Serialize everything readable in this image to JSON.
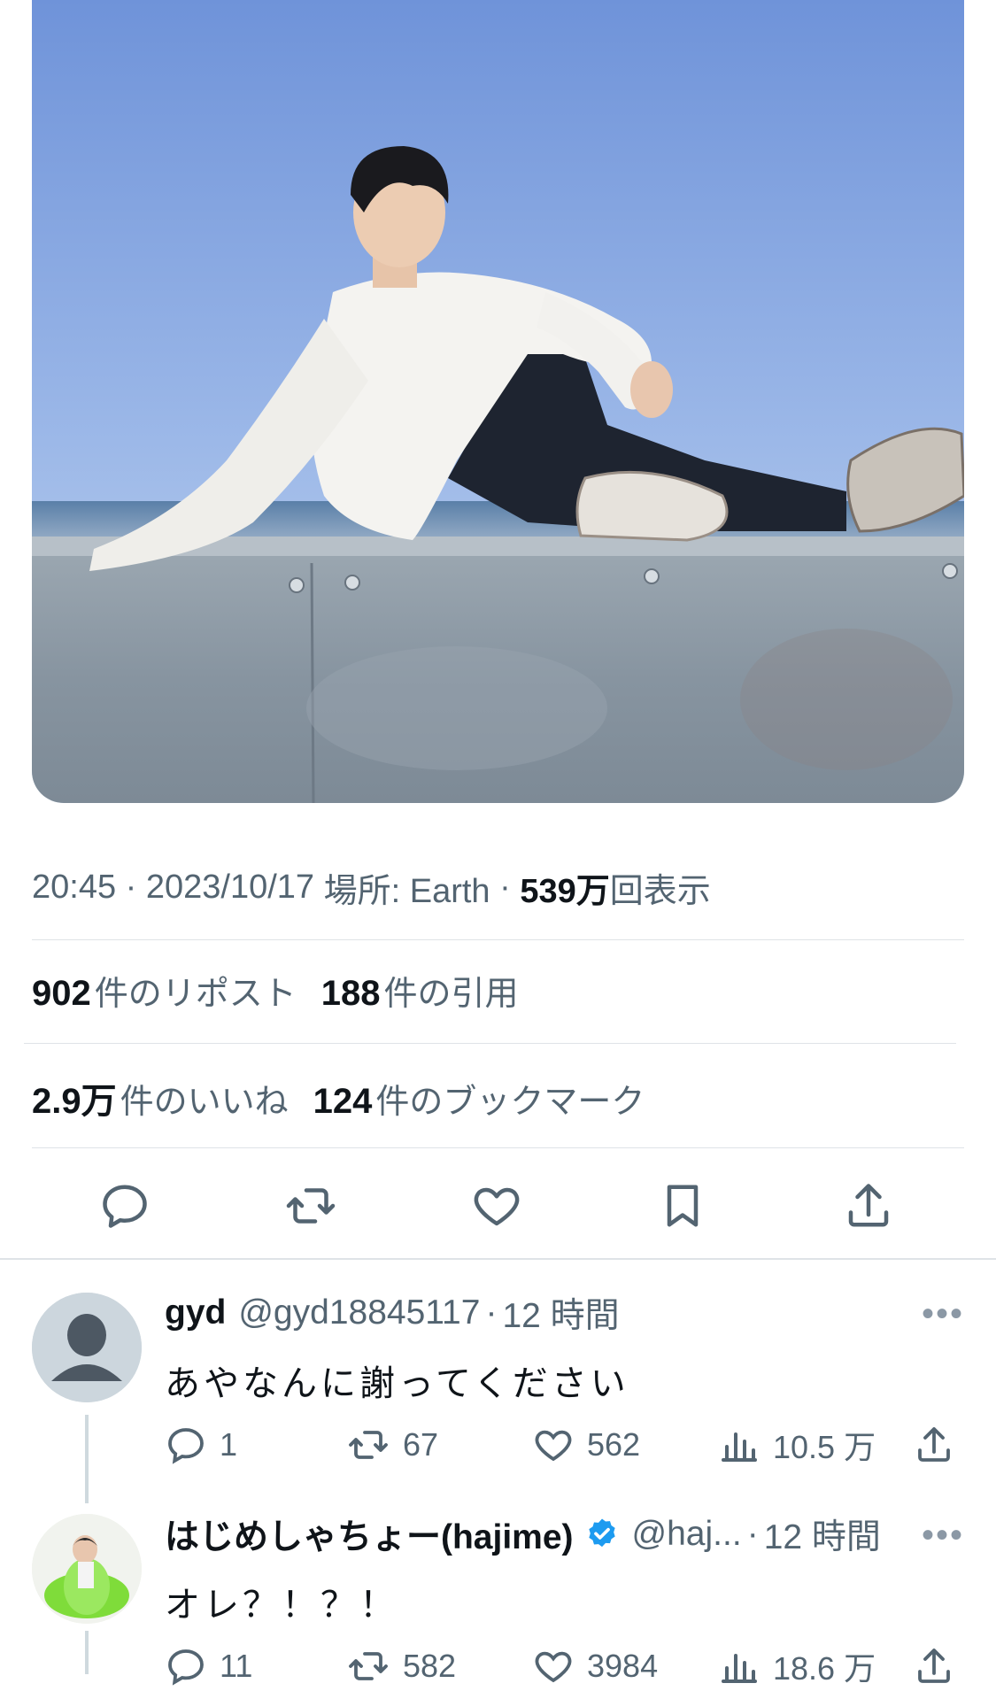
{
  "tweet": {
    "time": "20:45",
    "date": "2023/10/17",
    "location_label": "場所: Earth",
    "views_value": "539万",
    "views_label": "回表示",
    "reposts_value": "902",
    "reposts_label": "件のリポスト",
    "quotes_value": "188",
    "quotes_label": "件の引用",
    "likes_value": "2.9万",
    "likes_label": "件のいいね",
    "bookmarks_value": "124",
    "bookmarks_label": "件のブックマーク"
  },
  "actions": [
    "reply-icon",
    "repost-icon",
    "like-icon",
    "bookmark-icon",
    "share-icon"
  ],
  "replies": [
    {
      "name": "gyd",
      "handle": "@gyd18845117",
      "time": "12 時間",
      "text": "あやなんに謝ってください",
      "replies": "1",
      "reposts": "67",
      "likes": "562",
      "views": "10.5 万"
    },
    {
      "name": "はじめしゃちょー(hajime)",
      "handle": "@haj...",
      "time": "12 時間",
      "text": "オレ？！？！",
      "replies": "11",
      "reposts": "582",
      "likes": "3984",
      "views": "18.6 万",
      "verified": true
    }
  ],
  "colors": {
    "text": "#0f1419",
    "secondary": "#536471",
    "divider": "#dfe3e7",
    "verified": "#1d9bf0"
  }
}
